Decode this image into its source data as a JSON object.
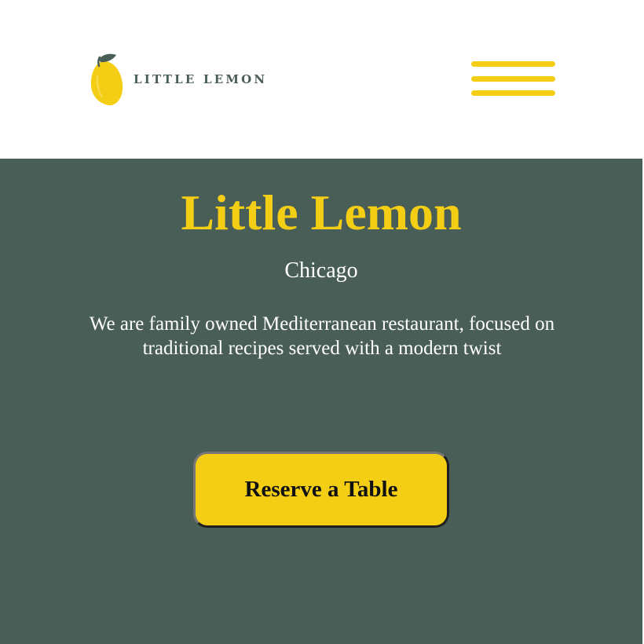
{
  "brand": {
    "logo_text": "LITTLE LEMON",
    "logo_icon": "lemon-icon"
  },
  "nav": {
    "menu_icon": "hamburger-menu-icon"
  },
  "hero": {
    "title": "Little Lemon",
    "city": "Chicago",
    "description": "We are family owned Mediterranean restaurant, focused on traditional recipes served with a modern twist",
    "cta_label": "Reserve a Table"
  },
  "colors": {
    "primary_green": "#495e57",
    "primary_yellow": "#f4ce14",
    "text_light": "#ffffff",
    "text_dark": "#111111"
  }
}
